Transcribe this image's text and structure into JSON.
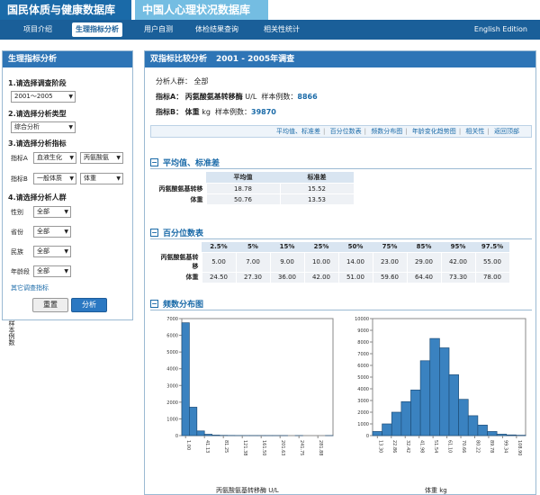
{
  "top_tabs": [
    "国民体质与健康数据库",
    "中国人心理状况数据库"
  ],
  "nav": {
    "items": [
      "项目介绍",
      "生理指标分析",
      "用户自测",
      "体检结果查询",
      "相关性统计"
    ],
    "active_index": 1,
    "edition": "English Edition"
  },
  "sidebar": {
    "title": "生理指标分析",
    "step1": "1.请选择调查阶段",
    "period": "2001～2005",
    "step2": "2.请选择分析类型",
    "analysis_type": "综合分析",
    "step3": "3.请选择分析指标",
    "metricA_label": "指标A",
    "metricA_cat": "血液生化",
    "metricA_val": "丙氨酸氨",
    "metricB_label": "指标B",
    "metricB_cat": "一般体质",
    "metricB_val": "体重",
    "step4": "4.请选择分析人群",
    "filters": [
      {
        "label": "性别",
        "value": "全部"
      },
      {
        "label": "省份",
        "value": "全部"
      },
      {
        "label": "民族",
        "value": "全部"
      },
      {
        "label": "年龄段",
        "value": "全部"
      }
    ],
    "more_link": "其它调查指标",
    "reset": "重置",
    "analyze": "分析"
  },
  "main": {
    "title": "双指标比较分析",
    "period": "2001 - 2005年调查",
    "population_label": "分析人群：",
    "population_value": "全部",
    "a_label": "指标A：",
    "a_name": "丙氨酸氨基转移酶",
    "a_unit": "U/L",
    "a_count_label": "样本例数：",
    "a_count": "8866",
    "b_label": "指标B：",
    "b_name": "体重",
    "b_unit": "kg",
    "b_count_label": "样本例数：",
    "b_count": "39870",
    "subnav": [
      "平均值、标准差",
      "百分位数表",
      "频数分布图",
      "年龄变化趋势图",
      "相关性",
      "返回顶部"
    ]
  },
  "mean_section": {
    "title": "平均值、标准差",
    "headers": [
      "平均值",
      "标准差"
    ],
    "rows": [
      {
        "label": "丙氨酸氨基转移",
        "mean": "18.78",
        "sd": "15.52"
      },
      {
        "label": "体重",
        "mean": "50.76",
        "sd": "13.53"
      }
    ]
  },
  "percentile_section": {
    "title": "百分位数表",
    "headers": [
      "2.5%",
      "5%",
      "15%",
      "25%",
      "50%",
      "75%",
      "85%",
      "95%",
      "97.5%"
    ],
    "rows": [
      {
        "label": "丙氨酸氨基转移",
        "values": [
          "5.00",
          "7.00",
          "9.00",
          "10.00",
          "14.00",
          "23.00",
          "29.00",
          "42.00",
          "55.00"
        ]
      },
      {
        "label": "体重",
        "values": [
          "24.50",
          "27.30",
          "36.00",
          "42.00",
          "51.00",
          "59.60",
          "64.40",
          "73.30",
          "78.00"
        ]
      }
    ]
  },
  "freq_section": {
    "title": "频数分布图"
  },
  "chart_data": [
    {
      "type": "bar",
      "title": "",
      "xlabel": "丙氨酸氨基转移酶 U/L",
      "ylabel": "样本例数",
      "ylim": [
        0,
        7000
      ],
      "yticks": [
        0,
        1000,
        2000,
        3000,
        4000,
        5000,
        6000,
        7000
      ],
      "xticks": [
        "1.00",
        "41.13",
        "81.25",
        "121.38",
        "161.50",
        "201.63",
        "241.75",
        "281.88"
      ],
      "values": [
        6750,
        1700,
        280,
        80,
        30,
        15,
        10,
        5,
        3,
        2,
        1,
        1,
        1,
        1,
        0,
        1,
        0,
        0,
        0,
        1
      ]
    },
    {
      "type": "bar",
      "title": "",
      "xlabel": "体重 kg",
      "ylabel": "",
      "ylim": [
        0,
        10000
      ],
      "yticks": [
        0,
        1000,
        2000,
        3000,
        4000,
        5000,
        6000,
        7000,
        8000,
        9000,
        10000
      ],
      "xticks": [
        "13.30",
        "22.86",
        "32.42",
        "41.98",
        "51.54",
        "61.10",
        "70.66",
        "80.22",
        "89.78",
        "99.34",
        "108.90"
      ],
      "values": [
        350,
        1000,
        2000,
        2900,
        3900,
        6400,
        8300,
        7500,
        5200,
        3100,
        1700,
        900,
        350,
        120,
        60,
        30
      ]
    }
  ]
}
